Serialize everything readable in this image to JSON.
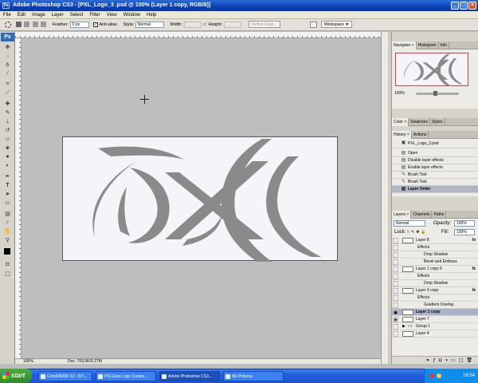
{
  "window": {
    "title": "Adobe Photoshop CS3 - [PXL_Logo_3 .psd @ 100% (Layer 1 copy, RGB/8)]",
    "app_icon": "Ps",
    "minimize": "_",
    "maximize": "□",
    "close": "×"
  },
  "menu": [
    "File",
    "Edit",
    "Image",
    "Layer",
    "Select",
    "Filter",
    "View",
    "Window",
    "Help"
  ],
  "options": {
    "feather_label": "Feather:",
    "feather_value": "0 px",
    "antialias_label": "Anti-alias",
    "style_label": "Style:",
    "style_value": "Normal",
    "width_label": "Width:",
    "height_label": "Height:",
    "refine_edge": "Refine Edge...",
    "workspace": "Workspace ▼"
  },
  "toolbox": {
    "badge": "Ps"
  },
  "document": {
    "logo_text": "PXL",
    "status_zoom": "100%",
    "status_doc": "Doc: 703.5K/9.27M"
  },
  "navigator": {
    "tabs": [
      "Navigator ×",
      "Histogram",
      "Info"
    ],
    "zoom": "100%"
  },
  "color_panel": {
    "tabs": [
      "Color ×",
      "Swatches",
      "Styles"
    ]
  },
  "history": {
    "tabs": [
      "History ×",
      "Actions"
    ],
    "snapshot": "PXL_Logo_3.psd",
    "items": [
      {
        "label": "Open",
        "icon": "document-icon"
      },
      {
        "label": "Disable layer effects",
        "icon": "document-icon"
      },
      {
        "label": "Enable layer effects",
        "icon": "document-icon"
      },
      {
        "label": "Brush Tool",
        "icon": "brush-icon"
      },
      {
        "label": "Brush Tool",
        "icon": "brush-icon"
      },
      {
        "label": "Layer Order",
        "icon": "layers-icon"
      }
    ]
  },
  "layers": {
    "tabs": [
      "Layers ×",
      "Channels",
      "Paths"
    ],
    "blend_mode": "Normal",
    "opacity_label": "Opacity:",
    "opacity_value": "100%",
    "lock_label": "Lock:",
    "fill_label": "Fill:",
    "fill_value": "100%",
    "rows": [
      {
        "name": "Layer 8",
        "fx": "fx",
        "kind": "layer"
      },
      {
        "name": "Effects",
        "kind": "effects"
      },
      {
        "name": "Drop Shadow",
        "kind": "effect"
      },
      {
        "name": "Bevel and Emboss",
        "kind": "effect"
      },
      {
        "name": "Layer 1 copy 6",
        "fx": "fx",
        "kind": "layer"
      },
      {
        "name": "Effects",
        "kind": "effects"
      },
      {
        "name": "Drop Shadow",
        "kind": "effect"
      },
      {
        "name": "Layer 9 copy",
        "fx": "fx",
        "kind": "layer"
      },
      {
        "name": "Effects",
        "kind": "effects"
      },
      {
        "name": "Gradient Overlay",
        "kind": "effect"
      },
      {
        "name": "Layer 1 copy",
        "kind": "layer",
        "selected": true
      },
      {
        "name": "Layer 7",
        "kind": "layer"
      },
      {
        "name": "Group 1",
        "kind": "group"
      },
      {
        "name": "Layer 4",
        "kind": "layer"
      }
    ]
  },
  "taskbar": {
    "start": "start",
    "tasks": [
      "CorelDRAW X3 - [D:\\...",
      "PXLEyes Logo Contes...",
      "Adobe Photoshop CS3...",
      "My Pictures"
    ],
    "clock": "16:54"
  },
  "colors": {
    "accent": "#0c3fb5",
    "logo": "#8a8a8a",
    "selected_layer": "#a9b3cc"
  }
}
